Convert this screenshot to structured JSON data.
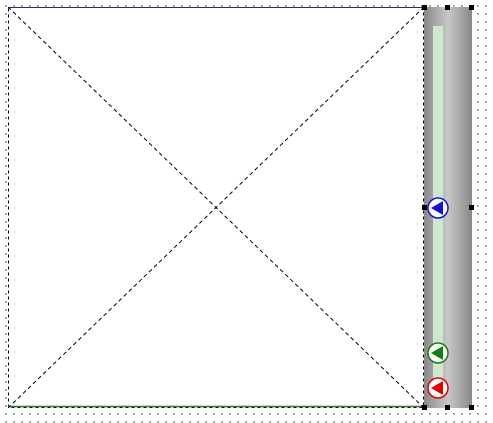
{
  "designer": {
    "placeholder": {
      "border_color": "#2a2a8a",
      "baseline_color": "#2a7a2a"
    },
    "trackbar": {
      "track_color": "#cfe6cf",
      "thumbs": [
        {
          "name": "blue",
          "color": "#1010e0",
          "level": 0.5
        },
        {
          "name": "green",
          "color": "#108010",
          "level": 0.09
        },
        {
          "name": "red",
          "color": "#e00000",
          "level": 0.0
        }
      ]
    }
  }
}
